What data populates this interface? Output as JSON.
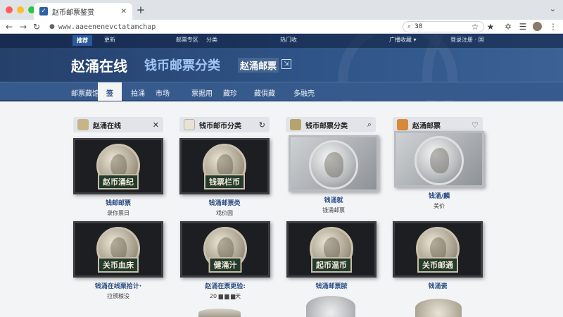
{
  "browser": {
    "tab_title": "赵币邮票鉴赏",
    "favicon_text": "✓",
    "tab_close": "✕",
    "new_tab": "+",
    "url": "www.aaeenenevctatamchap",
    "search_text": "38"
  },
  "site": {
    "topnav": [
      {
        "label": "推荐",
        "active": true
      },
      {
        "label": "更新"
      },
      {
        "label": "邮票专区"
      },
      {
        "label": "分类"
      },
      {
        "label": "热门收"
      },
      {
        "label": "广播收藏 ▾"
      },
      {
        "label": "登录注册 · 国"
      }
    ],
    "brand": "赵涌在线",
    "brand_sub": "钱币邮票分类",
    "brand_tag": "赵涌邮票",
    "brand_icon": "⇲",
    "catnav": [
      {
        "label": "邮票藏馆"
      },
      {
        "label": "签",
        "active": true
      },
      {
        "label": "拍涌"
      },
      {
        "label": "市场"
      },
      {
        "label": "票据用"
      },
      {
        "label": "藏珍"
      },
      {
        "label": "藏俱藏"
      },
      {
        "label": "多融壳"
      }
    ]
  },
  "panels": [
    {
      "title": "赵涌在线",
      "action": "✕",
      "icon_color": "#c9b48a"
    },
    {
      "title": "钱币邮币分类",
      "action": "↻",
      "icon_color": "#e8e2d2"
    },
    {
      "title": "钱币邮票分类",
      "action": "🔍",
      "icon_color": "#b8a36c"
    },
    {
      "title": "赵涌邮票",
      "action": "♡",
      "icon_color": "#d88a3a"
    }
  ],
  "cards": [
    {
      "label": "赵币涌纪",
      "title": "钱邮邮票",
      "sub": "录你票日",
      "light": false
    },
    {
      "label": "钱票栏币",
      "title": "钱涌邮票类",
      "sub": "戏价圆",
      "light": false
    },
    {
      "label": "",
      "title": "钱涌就",
      "sub": "钱涌邮票",
      "light": true
    },
    {
      "label": "",
      "title": "钱涌/麟",
      "sub": "美价",
      "light": true
    },
    {
      "label": "关币血床",
      "title": "钱涌在线栗拾计·",
      "sub": "拉颁粮没",
      "light": false
    },
    {
      "label": "健涌汁",
      "title": "赵涌在票更验:",
      "sub": "20 ▆ ▆ ▆天",
      "light": false
    },
    {
      "label": "起币温币",
      "title": "钱涌邮票脓",
      "sub": "",
      "light": false
    },
    {
      "label": "关币邮通",
      "title": "钱涌瓷",
      "sub": "",
      "light": false
    }
  ],
  "colors": {
    "header_dark": "#25406b",
    "header_mid": "#2f5487",
    "catnav": "#375a8c",
    "title_blue": "#2b4d86",
    "mac_close": "#ff5f57",
    "mac_min": "#febc2e",
    "mac_max": "#28c840"
  }
}
